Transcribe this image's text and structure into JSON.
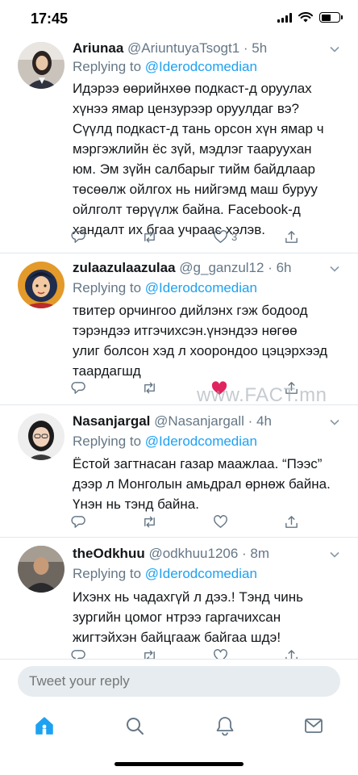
{
  "status_bar": {
    "time": "17:45"
  },
  "tweets": [
    {
      "name": "Ariunaa",
      "handle": "@AriuntuyaTsogt1 · 5h",
      "replying_prefix": "Replying to ",
      "replying_to": "@Iderodcomedian",
      "lines": [
        "Идэрээ өөрийнхөө подкаст-д оруулах",
        "хүнээ ямар цензурээр оруулдаг вэ?",
        "Сүүлд подкаст-д тань орсон хүн ямар ч",
        "мэргэжлийн ёс зүй, мэдлэг таарууxан",
        "юм. Эм зүйн салбарыг тийм байдлаар",
        "төсөөлж ойлгох нь нийгэмд маш буруу",
        "ойлголт төрүүлж байна. Facebook-д",
        "хандалт их бгаа учраас хэлэв."
      ],
      "like_count": "3"
    },
    {
      "name": "zulaazulaazulaa",
      "handle": "@g_ganzul12 · 6h",
      "replying_prefix": "Replying to ",
      "replying_to": "@Iderodcomedian",
      "lines": [
        "твитер орчингоо дийлэнх гэж бодоод",
        "тэрэндээ итгэчихсэн.үнэндээ нөгөө",
        "улиг болсон хэд л хоорондоо цэцэрхээд",
        "таардагшд"
      ],
      "like_count": ""
    },
    {
      "name": "Nasanjargal",
      "handle": "@Nasanjargall · 4h",
      "replying_prefix": "Replying to ",
      "replying_to": "@Iderodcomedian",
      "lines": [
        "Ёстой загтнасан газар маажлаа. “Пээс”",
        "дээр л Монголын амьдрал өрнөж байна.",
        "Үнэн нь тэнд байна."
      ],
      "like_count": ""
    },
    {
      "name": "theOdkhuu",
      "handle": "@odkhuu1206 · 8m",
      "replying_prefix": "Replying to ",
      "replying_to": "@Iderodcomedian",
      "lines": [
        "Ихэнх нь чадахгүй л дээ.! Тэнд чинь",
        "зургийн цомог нтрээ гаргачихсан",
        "жигтэйхэн байцгааж байгаа шдэ!"
      ],
      "like_count": ""
    }
  ],
  "watermark": "www.FACT.mn",
  "reply": {
    "placeholder": "Tweet your reply"
  },
  "colors": {
    "accent": "#1da1f2",
    "secondary_text": "#657786",
    "divider": "#e1e8ed",
    "like_red": "#e0245e"
  },
  "tabs": [
    "home-icon",
    "search-icon",
    "notifications-icon",
    "messages-icon"
  ]
}
